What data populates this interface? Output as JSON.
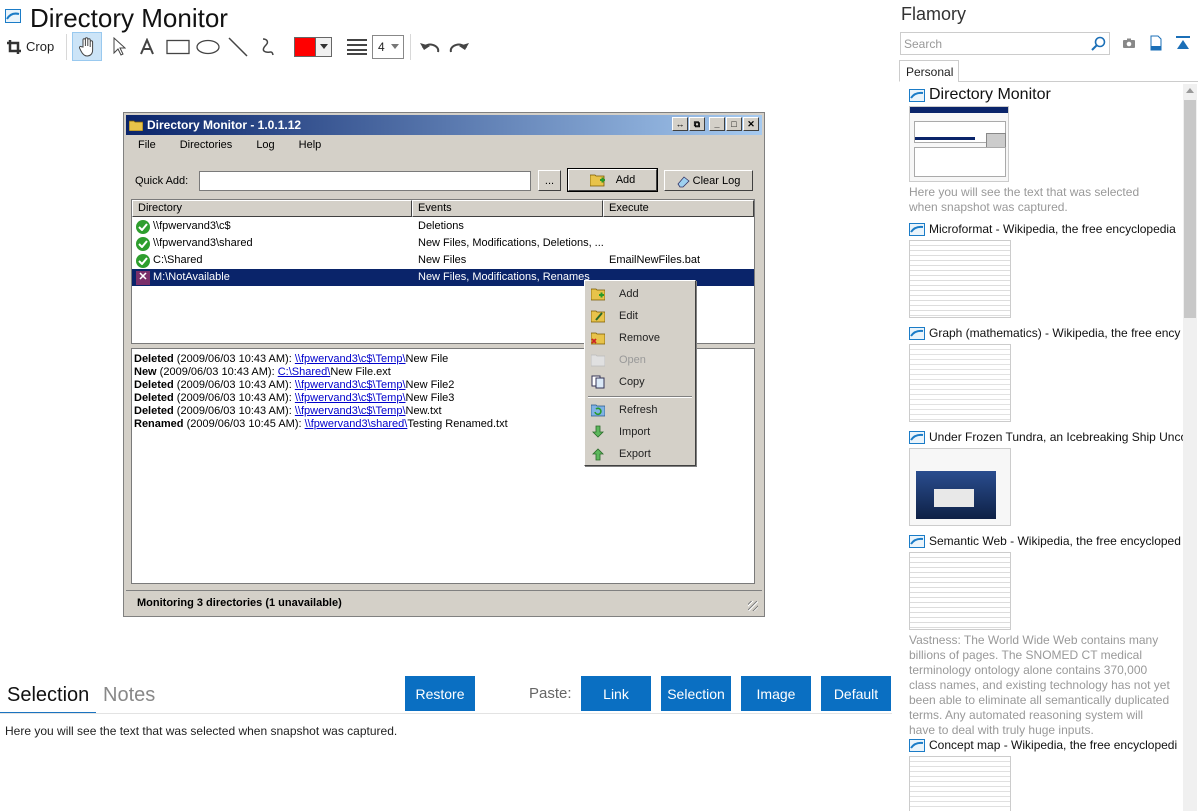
{
  "header": {
    "title": "Directory Monitor",
    "crop_label": "Crop",
    "color_value": "#ff0000",
    "line_width": "4"
  },
  "window": {
    "title": "Directory Monitor - 1.0.1.12",
    "menu": [
      "File",
      "Directories",
      "Log",
      "Help"
    ],
    "quick_add_label": "Quick Add:",
    "browse_label": "...",
    "add_label": "Add",
    "clear_log_label": "Clear Log",
    "columns": [
      "Directory",
      "Events",
      "Execute"
    ],
    "rows": [
      {
        "directory": "\\\\fpwervand3\\c$",
        "events": "Deletions",
        "execute": "",
        "status": "ok"
      },
      {
        "directory": "\\\\fpwervand3\\shared",
        "events": "New Files, Modifications, Deletions, ...",
        "execute": "",
        "status": "ok"
      },
      {
        "directory": "C:\\Shared",
        "events": "New Files",
        "execute": "EmailNewFiles.bat",
        "status": "ok"
      },
      {
        "directory": "M:\\NotAvailable",
        "events": "New Files, Modifications, Renames",
        "execute": "",
        "status": "error"
      }
    ],
    "log": [
      {
        "kind": "Deleted",
        "time": " (2009/06/03 10:43 AM): ",
        "link": "\\\\fpwervand3\\c$\\Temp\\",
        "file": "New File"
      },
      {
        "kind": "New",
        "time": " (2009/06/03 10:43 AM): ",
        "link": "C:\\Shared\\",
        "file": "New File.ext"
      },
      {
        "kind": "Deleted",
        "time": " (2009/06/03 10:43 AM): ",
        "link": "\\\\fpwervand3\\c$\\Temp\\",
        "file": "New File2"
      },
      {
        "kind": "Deleted",
        "time": " (2009/06/03 10:43 AM): ",
        "link": "\\\\fpwervand3\\c$\\Temp\\",
        "file": "New File3"
      },
      {
        "kind": "Deleted",
        "time": " (2009/06/03 10:43 AM): ",
        "link": "\\\\fpwervand3\\c$\\Temp\\",
        "file": "New.txt"
      },
      {
        "kind": "Renamed",
        "time": " (2009/06/03 10:45 AM): ",
        "link": "\\\\fpwervand3\\shared\\",
        "file": "Testing Renamed.txt"
      }
    ],
    "status": "Monitoring 3 directories (1 unavailable)",
    "context_menu": [
      "Add",
      "Edit",
      "Remove",
      "Open",
      "Copy",
      "Refresh",
      "Import",
      "Export"
    ]
  },
  "bottom": {
    "tab_selection": "Selection",
    "tab_notes": "Notes",
    "restore_label": "Restore",
    "paste_label": "Paste:",
    "link_label": "Link",
    "selection_label": "Selection",
    "image_label": "Image",
    "default_label": "Default",
    "selection_text": "Here you will see the text that was selected when snapshot was captured."
  },
  "sidebar": {
    "title": "Flamory",
    "search_placeholder": "Search",
    "tab": "Personal",
    "entries": [
      {
        "title": "Directory Monitor",
        "desc": "Here you will see the text that was selected when snapshot was captured."
      },
      {
        "title": "Microformat - Wikipedia, the free encyclopedia",
        "desc": ""
      },
      {
        "title": "Graph (mathematics) - Wikipedia, the free ency",
        "desc": ""
      },
      {
        "title": "Under Frozen Tundra, an Icebreaking Ship Unco",
        "desc": ""
      },
      {
        "title": "Semantic Web - Wikipedia, the free encycloped",
        "desc": "Vastness: The World Wide Web contains many billions of pages. The SNOMED CT medical terminology ontology alone contains 370,000 class names, and existing technology has not yet been able to eliminate all semantically duplicated terms. Any automated reasoning system will have to deal with truly huge inputs."
      },
      {
        "title": "Concept map - Wikipedia, the free encyclopedi",
        "desc": ""
      }
    ]
  },
  "colors": {
    "accent": "#0a6fc2",
    "titlebar": "#0a246a",
    "selected_row": "#0a246a"
  }
}
